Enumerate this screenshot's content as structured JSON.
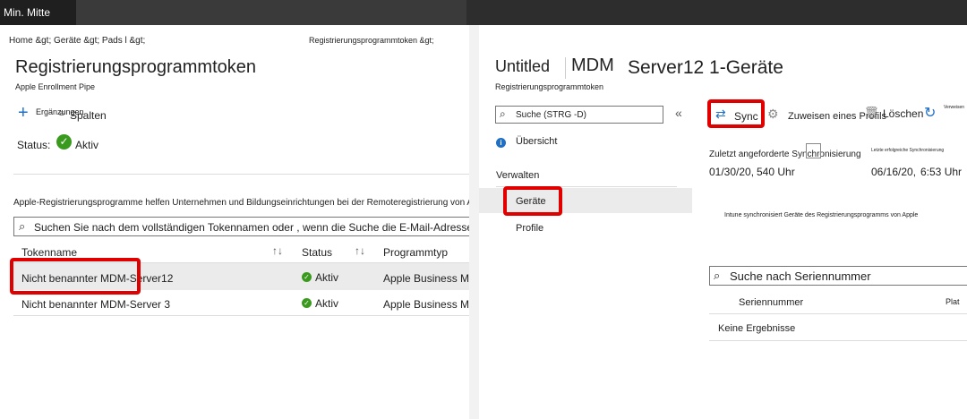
{
  "topbar": {
    "title": "Min. Mitte"
  },
  "left": {
    "breadcrumb": "Home &gt;  Geräte &gt; Pads l &gt;",
    "page_title": "Registrierungsprogrammtoken",
    "subtitle": "Apple Enrollment Pipe",
    "toolbar": {
      "add_label": "Ergänzungen",
      "columns_label": "Spalten"
    },
    "status": {
      "label": "Status:",
      "value": "Aktiv"
    },
    "description": "Apple-Registrierungsprogramme helfen Unternehmen und Bildungseinrichtungen bei der Remoteregistrierung von Apple Dev.",
    "search_placeholder": "Suchen Sie nach dem vollständigen Tokennamen oder , wenn die Suche die E-Mail-Adresse enthält",
    "table": {
      "headers": [
        "Tokenname",
        "Status",
        "Programmtyp"
      ],
      "rows": [
        {
          "name": "Nicht benannter MDM-Server12",
          "status": "Aktiv",
          "type": "Apple Business Me"
        },
        {
          "name": "Nicht benannter MDM-Server 3",
          "status": "Aktiv",
          "type": "Apple Business Me"
        }
      ]
    }
  },
  "right": {
    "breadcrumb": "Registrierungsprogrammtoken &gt;",
    "title_untitled": "Untitled",
    "title_mdm": "MDM",
    "title_rest": "Server12 1-Geräte",
    "subtitle": "Registrierungsprogrammtoken",
    "nav_search_placeholder": "Suche (STRG -D)",
    "nav": {
      "overview": "Übersicht",
      "manage_header": "Verwalten",
      "devices": "Geräte",
      "profiles": "Profile"
    },
    "toolbar": {
      "sync": "Sync",
      "assign": "Zuweisen eines Profils",
      "delete": "Löschen",
      "refresh_caption": "Verweisen"
    },
    "sync_info": {
      "requested_label": "Zuletzt angeforderte Synchronisierung",
      "requested_date": "01/30/20,",
      "requested_time": "540 Uhr",
      "success_label": "Letzte erfolgreiche Synchronisierung",
      "success_date": "06/16/20,",
      "success_time": "6:53 Uhr"
    },
    "info_text": "Intune synchronisiert Geräte des Registrierungsprogramms von Apple",
    "serial_search_placeholder": "Suche nach Seriennummer",
    "table": {
      "headers": [
        "Seriennummer",
        "Plat"
      ],
      "empty": "Keine Ergebnisse"
    }
  }
}
